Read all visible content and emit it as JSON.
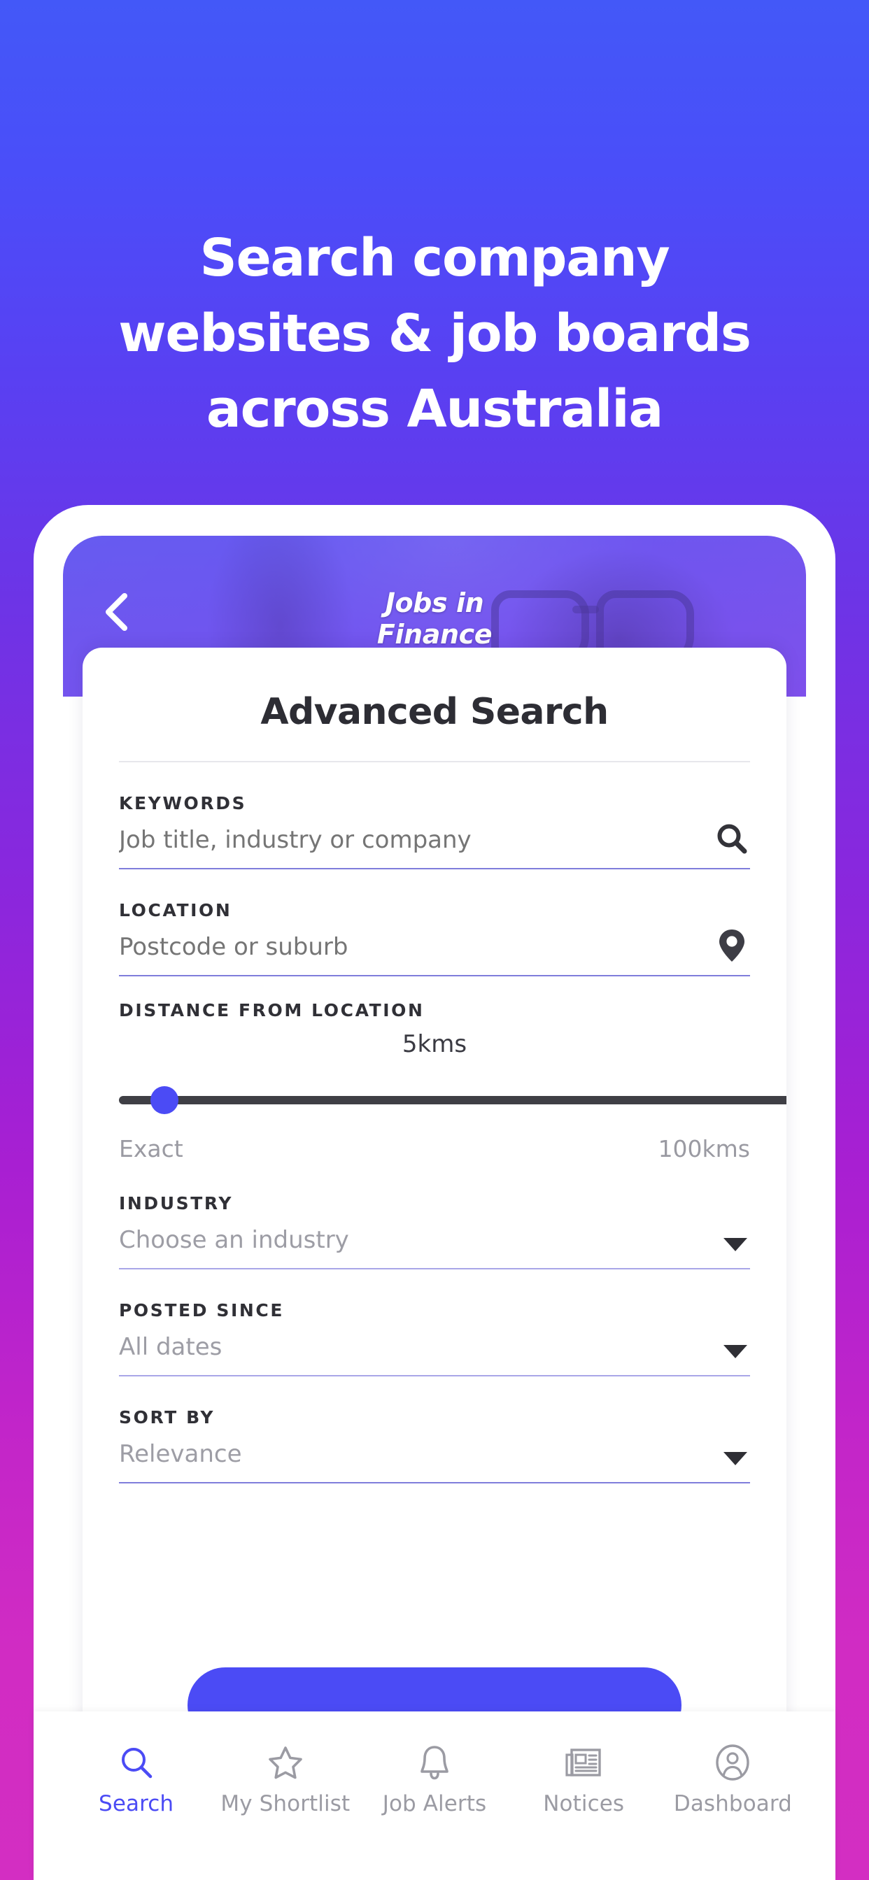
{
  "hero": {
    "heading": "Search company\nwebsites & job boards\nacross Australia"
  },
  "phone": {
    "screen_title": "Jobs in\nFinance",
    "back_icon": "chevron-left-icon"
  },
  "form": {
    "title": "Advanced Search",
    "keywords": {
      "label": "KEYWORDS",
      "placeholder": "Job title, industry or company",
      "value": "",
      "icon": "search-icon"
    },
    "location": {
      "label": "LOCATION",
      "placeholder": "Postcode or suburb",
      "value": "",
      "icon": "map-pin-icon"
    },
    "distance": {
      "label": "DISTANCE FROM LOCATION",
      "value_text": "5kms",
      "value": 5,
      "min": 0,
      "max": 100,
      "min_label": "Exact",
      "max_label": "100kms"
    },
    "industry": {
      "label": "INDUSTRY",
      "selected": "Choose an industry",
      "icon": "chevron-down-icon"
    },
    "posted_since": {
      "label": "POSTED SINCE",
      "selected": "All dates",
      "icon": "chevron-down-icon"
    },
    "sort_by": {
      "label": "SORT BY",
      "selected": "Relevance",
      "icon": "chevron-down-icon"
    },
    "submit_label": ""
  },
  "bottom_nav": {
    "items": [
      {
        "label": "Search",
        "icon": "search-icon",
        "active": true
      },
      {
        "label": "My Shortlist",
        "icon": "star-icon",
        "active": false
      },
      {
        "label": "Job Alerts",
        "icon": "bell-icon",
        "active": false
      },
      {
        "label": "Notices",
        "icon": "newspaper-icon",
        "active": false
      },
      {
        "label": "Dashboard",
        "icon": "user-circle-icon",
        "active": false
      }
    ]
  },
  "colors": {
    "gradient_top": "#4358f8",
    "gradient_bottom": "#d32ec2",
    "accent": "#4b4bf5",
    "muted_text": "#9d9da5",
    "dark_text": "#2d2d34"
  }
}
